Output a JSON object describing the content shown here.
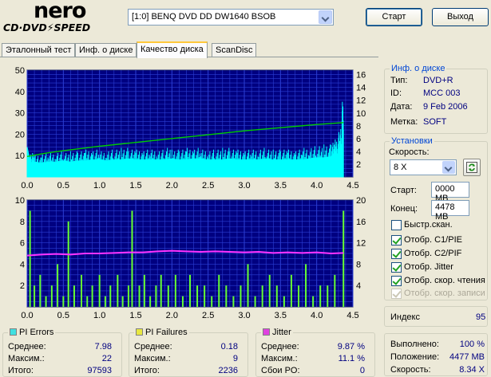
{
  "app": {
    "logo_top": "nero",
    "logo_bottom": "CD·DVD⚡SPEED",
    "drive": "[1:0]   BENQ DVD DD DW1640 BSOB",
    "start_label": "Старт",
    "exit_label": "Выход"
  },
  "tabs": [
    {
      "label": "Эталонный тест",
      "active": false
    },
    {
      "label": "Инф. о диске",
      "active": false
    },
    {
      "label": "Качество диска",
      "active": true
    },
    {
      "label": "ScanDisc",
      "active": false
    }
  ],
  "disc_info": {
    "title": "Инф. о диске",
    "rows": [
      {
        "label": "Тип:",
        "value": "DVD+R"
      },
      {
        "label": "ID:",
        "value": "MCC 003"
      },
      {
        "label": "Дата:",
        "value": "9 Feb 2006"
      },
      {
        "label": "Метка:",
        "value": "SOFT"
      }
    ]
  },
  "settings": {
    "title": "Установки",
    "speed_label": "Скорость:",
    "speed_value": "8 X",
    "start_label": "Старт:",
    "start_value": "0000 MB",
    "end_label": "Конец:",
    "end_value": "4478 MB",
    "checkboxes": [
      {
        "label": "Быстр.скан.",
        "checked": false,
        "disabled": false
      },
      {
        "label": "Отобр. C1/PIE",
        "checked": true,
        "disabled": false
      },
      {
        "label": "Отобр. C2/PIF",
        "checked": true,
        "disabled": false
      },
      {
        "label": "Отобр. Jitter",
        "checked": true,
        "disabled": false
      },
      {
        "label": "Отобр. скор. чтения",
        "checked": true,
        "disabled": false
      },
      {
        "label": "Отобр. скор. записи",
        "checked": true,
        "disabled": true
      }
    ]
  },
  "index": {
    "label": "Индекс",
    "value": "95"
  },
  "progress": {
    "rows": [
      {
        "label": "Выполнено:",
        "value": "100 %"
      },
      {
        "label": "Положение:",
        "value": "4477 MB"
      },
      {
        "label": "Скорость:",
        "value": "8.34 X"
      }
    ]
  },
  "stats": {
    "pi_errors": {
      "title": "PI Errors",
      "color": "#40e0e0",
      "rows": [
        {
          "label": "Среднее:",
          "value": "7.98"
        },
        {
          "label": "Максим.:",
          "value": "22"
        },
        {
          "label": "Итого:",
          "value": "97593"
        }
      ]
    },
    "pi_failures": {
      "title": "PI Failures",
      "color": "#e8e840",
      "rows": [
        {
          "label": "Среднее:",
          "value": "0.18"
        },
        {
          "label": "Максим.:",
          "value": "9"
        },
        {
          "label": "Итого:",
          "value": "2236"
        }
      ]
    },
    "jitter": {
      "title": "Jitter",
      "color": "#e040e0",
      "rows": [
        {
          "label": "Среднее:",
          "value": "9.87 %"
        },
        {
          "label": "Максим.:",
          "value": "11.1 %"
        },
        {
          "label": "Сбои PO:",
          "value": "0"
        }
      ]
    }
  },
  "chart_data": [
    {
      "type": "area",
      "x_ticks": [
        "0.0",
        "0.5",
        "1.0",
        "1.5",
        "2.0",
        "2.5",
        "3.0",
        "3.5",
        "4.0",
        "4.5"
      ],
      "left_ticks": [
        "10",
        "20",
        "30",
        "40",
        "50"
      ],
      "right_ticks": [
        "2",
        "4",
        "6",
        "8",
        "10",
        "12",
        "14",
        "16"
      ],
      "xlim": [
        0,
        4.5
      ],
      "ylim_left": [
        0,
        50
      ],
      "ylim_right": [
        0,
        16.7
      ],
      "grid": true,
      "colors": {
        "bg": "#000080",
        "grid": "#2b3fd4",
        "errors": "#00ffff",
        "speed": "#00cc00"
      },
      "series": [
        {
          "key": "pi_errors",
          "axis": "left",
          "x": [
            0,
            0.05,
            0.1,
            0.2,
            0.3,
            0.4,
            0.5,
            0.6,
            0.7,
            0.8,
            0.9,
            1.0,
            1.1,
            1.2,
            1.3,
            1.4,
            1.5,
            1.6,
            1.7,
            1.8,
            1.9,
            2.0,
            2.1,
            2.2,
            2.3,
            2.4,
            2.5,
            2.6,
            2.7,
            2.8,
            2.9,
            3.0,
            3.1,
            3.2,
            3.3,
            3.4,
            3.5,
            3.6,
            3.7,
            3.8,
            3.9,
            4.0,
            4.1,
            4.2,
            4.25,
            4.3,
            4.35,
            4.37
          ],
          "y": [
            14,
            6,
            7,
            6.5,
            7,
            7,
            7.5,
            7,
            7.5,
            7.5,
            8,
            8,
            7.5,
            8,
            8,
            8.5,
            8,
            8,
            8,
            8,
            8,
            8.5,
            8,
            8,
            8.5,
            8.5,
            8,
            8,
            8,
            8.5,
            8,
            8,
            8,
            8,
            8.5,
            8,
            8,
            8,
            8,
            8,
            8.5,
            9,
            9,
            9.5,
            10,
            11,
            14,
            22
          ]
        },
        {
          "key": "read_speed",
          "axis": "right",
          "x": [
            0,
            0.1,
            0.2,
            0.3,
            0.5,
            1.0,
            1.5,
            2.0,
            2.5,
            3.0,
            3.5,
            4.0,
            4.37
          ],
          "y": [
            3.2,
            3.4,
            3.6,
            3.8,
            4.1,
            4.8,
            5.4,
            6.0,
            6.6,
            7.2,
            7.7,
            8.2,
            8.5
          ]
        }
      ]
    },
    {
      "type": "bar",
      "x_ticks": [
        "0.0",
        "0.5",
        "1.0",
        "1.5",
        "2.0",
        "2.5",
        "3.0",
        "3.5",
        "4.0",
        "4.5"
      ],
      "left_ticks": [
        "2",
        "4",
        "6",
        "8",
        "10"
      ],
      "right_ticks": [
        "4",
        "8",
        "12",
        "16",
        "20"
      ],
      "xlim": [
        0,
        4.5
      ],
      "ylim_left": [
        0,
        10
      ],
      "ylim_right": [
        0,
        20
      ],
      "grid": true,
      "colors": {
        "bg": "#000080",
        "grid": "#2b3fd4",
        "failures": "#66ff33",
        "jitter": "#ff33ff"
      },
      "series": [
        {
          "key": "pi_failures",
          "axis": "left",
          "x": [
            0.04,
            0.1,
            0.18,
            0.26,
            0.34,
            0.42,
            0.5,
            0.57,
            0.65,
            0.75,
            0.83,
            0.9,
            1.0,
            1.08,
            1.15,
            1.25,
            1.32,
            1.4,
            1.45,
            1.55,
            1.62,
            1.7,
            1.78,
            1.85,
            1.95,
            2.05,
            2.15,
            2.25,
            2.35,
            2.45,
            2.55,
            2.65,
            2.75,
            2.85,
            2.95,
            3.05,
            3.15,
            3.25,
            3.35,
            3.45,
            3.55,
            3.65,
            3.75,
            3.85,
            3.95,
            4.05,
            4.15,
            4.25,
            4.37
          ],
          "y": [
            9,
            2,
            3,
            1,
            2,
            4,
            1,
            8,
            2,
            3,
            1,
            2,
            3,
            1,
            2,
            3,
            1,
            2,
            9,
            2,
            3,
            1,
            2,
            3,
            2,
            3,
            1,
            3,
            2,
            2,
            1,
            3,
            2,
            1,
            2,
            4,
            1,
            2,
            3,
            2,
            1,
            3,
            2,
            4,
            1,
            2,
            2,
            3,
            9
          ]
        },
        {
          "key": "jitter",
          "axis": "right",
          "x": [
            0,
            0.2,
            0.4,
            0.6,
            0.8,
            1.0,
            1.2,
            1.4,
            1.6,
            1.8,
            2.0,
            2.2,
            2.4,
            2.6,
            2.8,
            3.0,
            3.2,
            3.4,
            3.6,
            3.8,
            4.0,
            4.2,
            4.37
          ],
          "y": [
            9.6,
            9.8,
            9.9,
            9.8,
            10.0,
            10.0,
            10.1,
            10.2,
            10.2,
            10.4,
            10.5,
            10.4,
            10.3,
            10.4,
            10.3,
            10.2,
            10.3,
            10.1,
            10.2,
            10.1,
            10.2,
            10.0,
            10.1
          ]
        }
      ]
    }
  ]
}
